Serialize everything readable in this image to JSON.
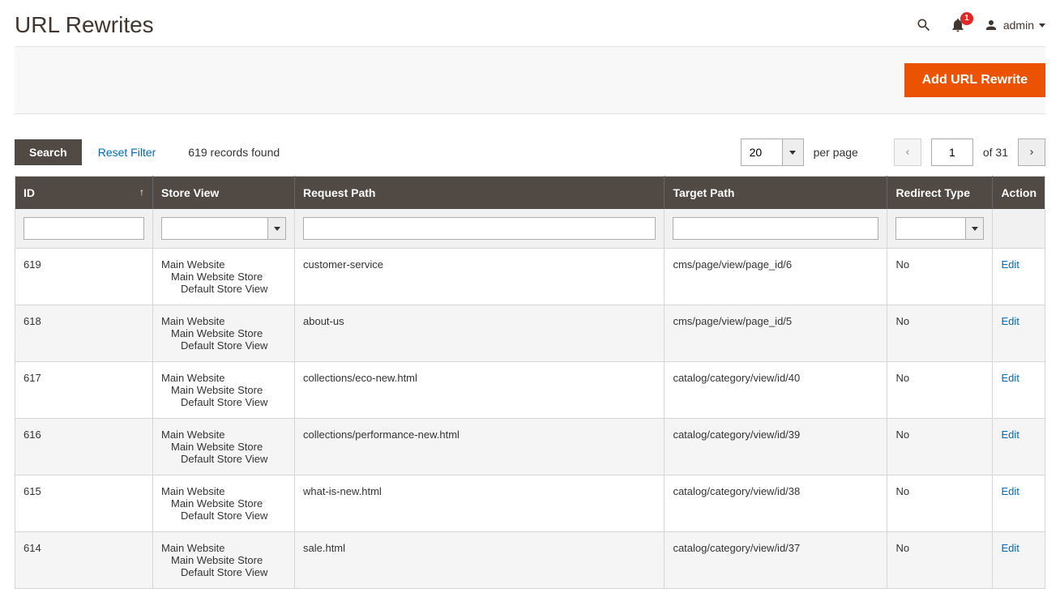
{
  "page": {
    "title": "URL Rewrites"
  },
  "header": {
    "notifications_count": "1",
    "username": "admin"
  },
  "actions": {
    "add_button": "Add URL Rewrite"
  },
  "toolbar": {
    "search_label": "Search",
    "reset_label": "Reset Filter",
    "records_found": "619 records found",
    "per_page_value": "20",
    "per_page_label": "per page",
    "current_page": "1",
    "total_pages_label": "of 31"
  },
  "columns": {
    "id": "ID",
    "store_view": "Store View",
    "request_path": "Request Path",
    "target_path": "Target Path",
    "redirect_type": "Redirect Type",
    "action": "Action"
  },
  "store_lines": {
    "l1": "Main Website",
    "l2": "Main Website Store",
    "l3": "Default Store View"
  },
  "edit_label": "Edit",
  "rows": [
    {
      "id": "619",
      "request": "customer-service",
      "target": "cms/page/view/page_id/6",
      "redirect": "No"
    },
    {
      "id": "618",
      "request": "about-us",
      "target": "cms/page/view/page_id/5",
      "redirect": "No"
    },
    {
      "id": "617",
      "request": "collections/eco-new.html",
      "target": "catalog/category/view/id/40",
      "redirect": "No"
    },
    {
      "id": "616",
      "request": "collections/performance-new.html",
      "target": "catalog/category/view/id/39",
      "redirect": "No"
    },
    {
      "id": "615",
      "request": "what-is-new.html",
      "target": "catalog/category/view/id/38",
      "redirect": "No"
    },
    {
      "id": "614",
      "request": "sale.html",
      "target": "catalog/category/view/id/37",
      "redirect": "No"
    }
  ]
}
